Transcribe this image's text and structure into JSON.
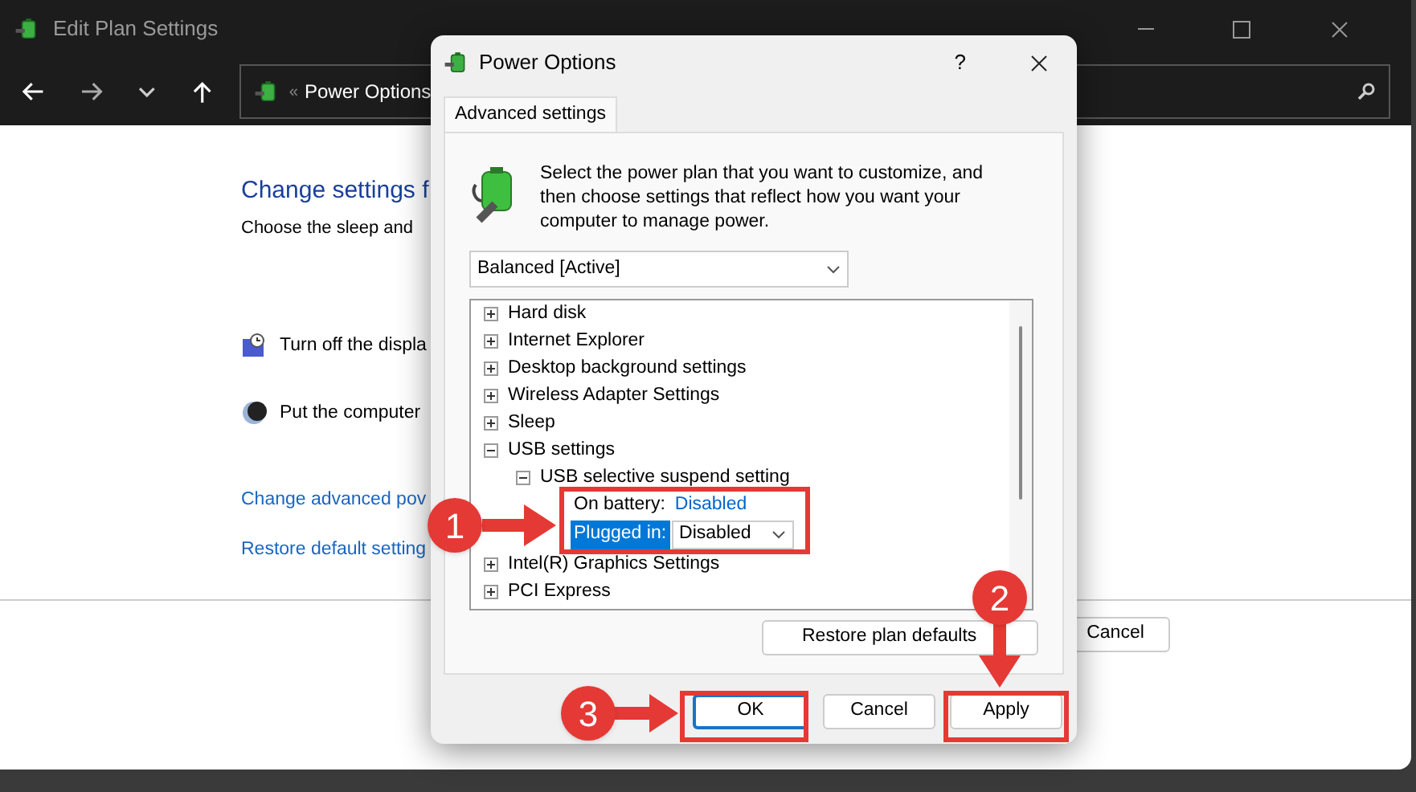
{
  "main_window": {
    "title": "Edit Plan Settings",
    "address_separator": "«",
    "address": "Power Options",
    "heading": "Change settings f",
    "subtitle": "Choose the sleep and",
    "settings": [
      {
        "kind": "display",
        "label": "Turn off the displa"
      },
      {
        "kind": "sleep",
        "label": "Put the computer"
      }
    ],
    "links": [
      "Change advanced pov",
      "Restore default setting"
    ],
    "cancel_button": "Cancel"
  },
  "dialog": {
    "title": "Power Options",
    "help": "?",
    "tabs": [
      {
        "label": "Advanced settings",
        "selected": true
      }
    ],
    "description": "Select the power plan that you want to customize, and then choose settings that reflect how you want your computer to manage power.",
    "plan_select": "Balanced [Active]",
    "tree": [
      {
        "label": "Hard disk",
        "expanded": false
      },
      {
        "label": "Internet Explorer",
        "expanded": false
      },
      {
        "label": "Desktop background settings",
        "expanded": false
      },
      {
        "label": "Wireless Adapter Settings",
        "expanded": false
      },
      {
        "label": "Sleep",
        "expanded": false
      },
      {
        "label": "USB settings",
        "expanded": true,
        "children": [
          {
            "label": "USB selective suspend setting",
            "expanded": true,
            "settings": [
              {
                "kind": "link",
                "label": "On battery:",
                "value": "Disabled",
                "selected": false
              },
              {
                "kind": "dropdown",
                "label": "Plugged in:",
                "value": "Disabled",
                "selected": true
              }
            ]
          }
        ]
      },
      {
        "label": "Intel(R) Graphics Settings",
        "expanded": false
      },
      {
        "label": "PCI Express",
        "expanded": false
      }
    ],
    "restore_button": "Restore plan defaults",
    "buttons": [
      {
        "label": "OK",
        "kind": "default"
      },
      {
        "label": "Cancel",
        "kind": "normal"
      },
      {
        "label": "Apply",
        "kind": "normal"
      }
    ]
  },
  "annotations": [
    "1",
    "2",
    "3"
  ]
}
